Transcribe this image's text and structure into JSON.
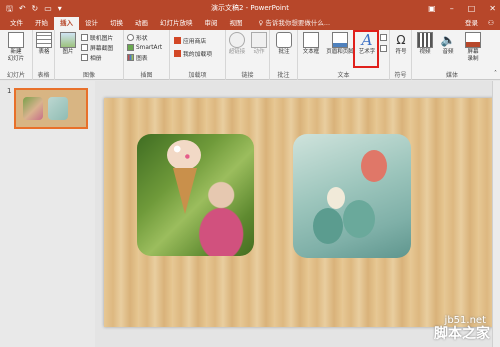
{
  "window": {
    "title": "演示文稿2 - PowerPoint"
  },
  "quick_access": {
    "save_icon": "save-icon",
    "undo_icon": "undo-icon",
    "redo_icon": "redo-icon",
    "start_icon": "start-from-beginning-icon",
    "customize_icon": "customize-qat-icon"
  },
  "tabs": [
    {
      "label": "文件"
    },
    {
      "label": "开始"
    },
    {
      "label": "插入"
    },
    {
      "label": "设计"
    },
    {
      "label": "切换"
    },
    {
      "label": "动画"
    },
    {
      "label": "幻灯片放映"
    },
    {
      "label": "审阅"
    },
    {
      "label": "视图"
    }
  ],
  "active_tab": "插入",
  "tell_me": "♀ 告诉我你想要做什么...",
  "account": {
    "login": "登录"
  },
  "ribbon": {
    "groups": {
      "slides": "幻灯片",
      "tables": "表格",
      "images": "图像",
      "illustrations": "插图",
      "addins": "加载项",
      "links": "链接",
      "comments": "批注",
      "text": "文本",
      "symbols": "符号",
      "media": "媒体"
    },
    "buttons": {
      "new_slide": "新建\n幻灯片",
      "table": "表格",
      "pictures": "图片",
      "online_pictures": "联机图片",
      "screenshot": "屏幕截图",
      "album": "相册",
      "shapes": "形状",
      "smartart": "SmartArt",
      "chart": "图表",
      "store": "应用商店",
      "my_addins": "我的加载项",
      "hyperlink": "超链接",
      "action": "动作",
      "comment": "批注",
      "textbox": "文本框",
      "header_footer": "页眉和页脚",
      "wordart": "艺术字",
      "symbols": "符号",
      "video": "视频",
      "audio": "音频",
      "screen_record": "屏幕\n录制"
    }
  },
  "thumbnails": [
    {
      "number": "1"
    }
  ],
  "watermark": {
    "line1": "jb51.net",
    "line2": "脚本之家"
  }
}
